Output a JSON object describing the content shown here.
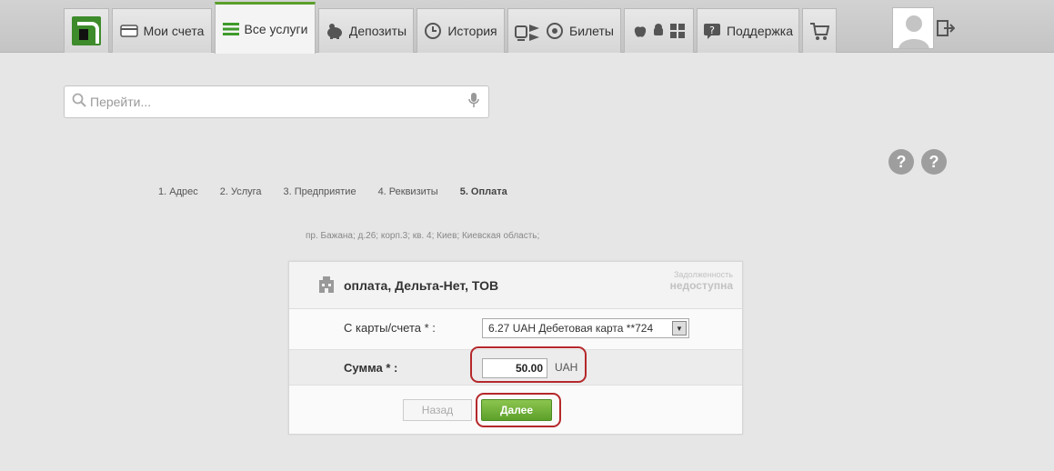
{
  "nav": {
    "tabs": [
      {
        "label": "",
        "icon": "privatbank-logo"
      },
      {
        "label": "Мои счета",
        "icon": "card-icon"
      },
      {
        "label": "Все услуги",
        "icon": "list-icon",
        "active": true
      },
      {
        "label": "Депозиты",
        "icon": "piggy-bank-icon"
      },
      {
        "label": "История",
        "icon": "history-icon"
      },
      {
        "label": "Билеты",
        "icon": "tickets-icon"
      },
      {
        "label": "",
        "icon": "mobile-platforms-icon"
      },
      {
        "label": "Поддержка",
        "icon": "support-icon"
      },
      {
        "label": "",
        "icon": "cart-icon"
      }
    ]
  },
  "search": {
    "placeholder": "Перейти..."
  },
  "steps": [
    "1.  Адрес",
    "2.  Услуга",
    "3.  Предприятие",
    "4.  Реквизиты",
    "5.  Оплата"
  ],
  "address": "пр. Бажана; д.26; корп.3; кв. 4; Киев; Киевская область;",
  "payment": {
    "title": "оплата, Дельта-Нет, ТОВ",
    "debt_line1": "Задолженность",
    "debt_line2": "недоступна",
    "card_label": "С карты/счета * :",
    "card_value": "6.27 UAH   Дебетовая карта **724",
    "amount_label": "Сумма * :",
    "amount_value": "50.00",
    "currency": "UAH",
    "back_label": "Назад",
    "next_label": "Далее"
  },
  "colors": {
    "accent_green": "#5aa02c",
    "highlight_red": "#b5282b"
  }
}
